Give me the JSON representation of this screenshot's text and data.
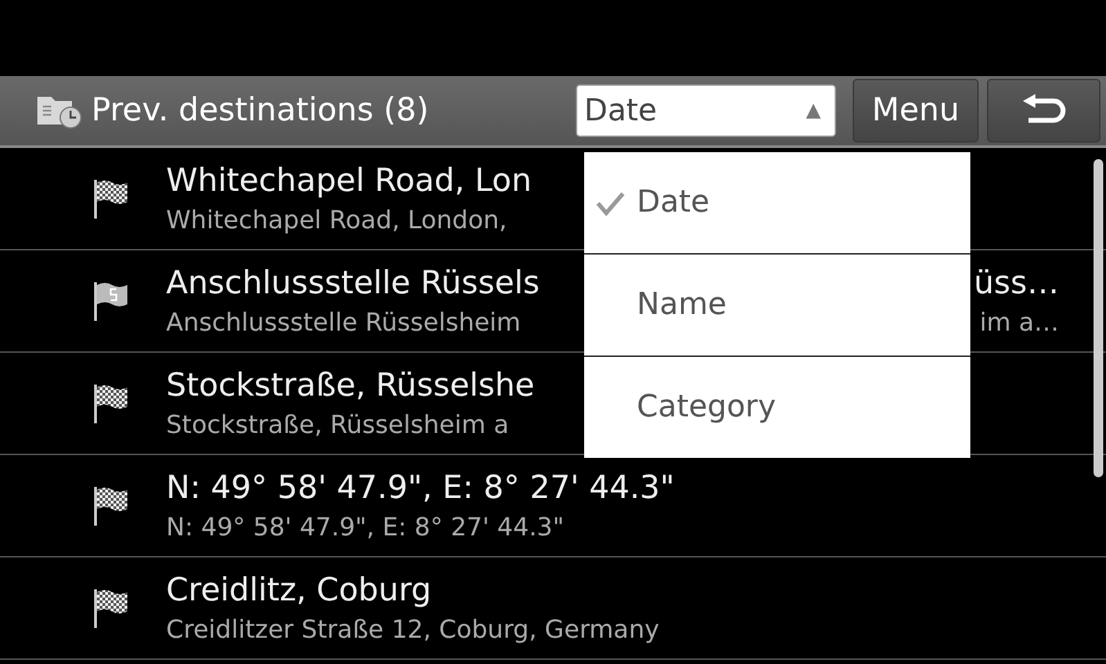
{
  "header": {
    "title": "Prev. destinations (8)",
    "sort_field": {
      "value": "Date",
      "arrow": "▲"
    },
    "menu_button": "Menu"
  },
  "destinations": [
    {
      "kind": "checkered",
      "title": "Whitechapel Road, Lon",
      "subtitle": "Whitechapel Road, London,"
    },
    {
      "kind": "start",
      "title": "Anschlussstelle Rüssels",
      "title_tail": "üss…",
      "subtitle": "Anschlussstelle Rüsselsheim",
      "subtitle_tail": "im a…"
    },
    {
      "kind": "checkered",
      "title": "Stockstraße, Rüsselshe",
      "subtitle": "Stockstraße, Rüsselsheim a"
    },
    {
      "kind": "checkered",
      "title": "N: 49° 58' 47.9\", E: 8° 27' 44.3\"",
      "subtitle": "N: 49° 58' 47.9\", E: 8° 27' 44.3\""
    },
    {
      "kind": "checkered",
      "title": "Creidlitz, Coburg",
      "subtitle": "Creidlitzer Straße 12, Coburg, Germany"
    }
  ],
  "sort_options": [
    {
      "label": "Date",
      "selected": true
    },
    {
      "label": "Name",
      "selected": false
    },
    {
      "label": "Category",
      "selected": false
    }
  ]
}
